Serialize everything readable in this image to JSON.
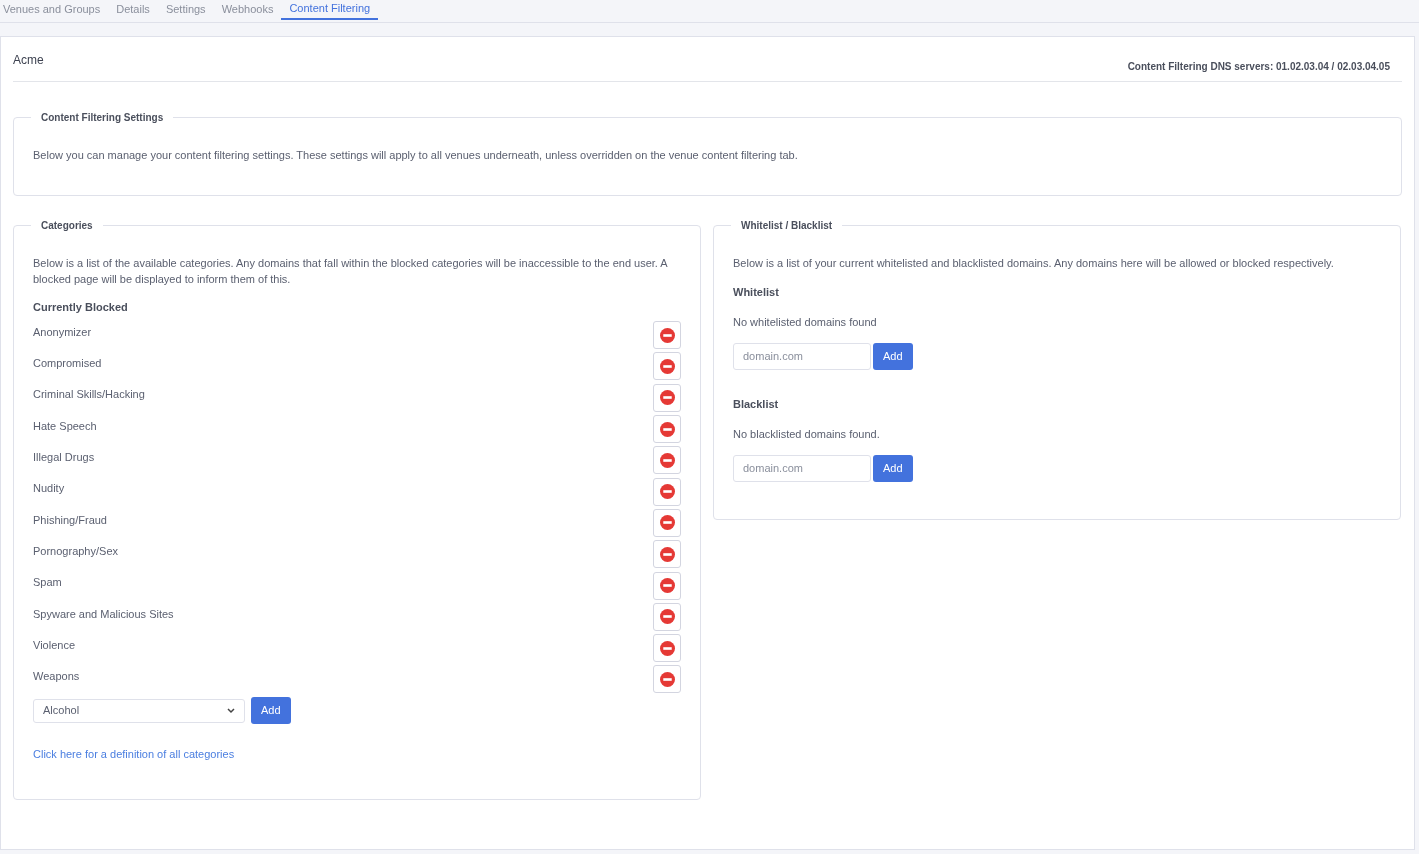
{
  "tabs": [
    {
      "label": "Venues and Groups",
      "selected": false
    },
    {
      "label": "Details",
      "selected": false
    },
    {
      "label": "Settings",
      "selected": false
    },
    {
      "label": "Webhooks",
      "selected": false
    },
    {
      "label": "Content Filtering",
      "selected": true
    }
  ],
  "header": {
    "title": "Acme",
    "dns_servers": "Content Filtering DNS servers: 01.02.03.04 / 02.03.04.05"
  },
  "settings": {
    "legend": "Content Filtering Settings",
    "description": "Below you can manage your content filtering settings. These settings will apply to all venues underneath, unless overridden on the venue content filtering tab."
  },
  "categories": {
    "legend": "Categories",
    "description": "Below is a list of the available categories. Any domains that fall within the blocked categories will be inaccessible to the end user. A blocked page will be displayed to inform them of this.",
    "blocked_heading": "Currently Blocked",
    "blocked": [
      "Anonymizer",
      "Compromised",
      "Criminal Skills/Hacking",
      "Hate Speech",
      "Illegal Drugs",
      "Nudity",
      "Phishing/Fraud",
      "Pornography/Sex",
      "Spam",
      "Spyware and Malicious Sites",
      "Violence",
      "Weapons"
    ],
    "select_value": "Alcohol",
    "add_button": "Add",
    "definition_link": "Click here for a definition of all categories"
  },
  "lists": {
    "legend": "Whitelist / Blacklist",
    "description": "Below is a list of your current whitelisted and blacklisted domains. Any domains here will be allowed or blocked respectively.",
    "sections": [
      {
        "heading": "Whitelist",
        "empty_text": "No whitelisted domains found",
        "placeholder": "domain.com",
        "add_button": "Add"
      },
      {
        "heading": "Blacklist",
        "empty_text": "No blacklisted domains found.",
        "placeholder": "domain.com",
        "add_button": "Add"
      }
    ]
  }
}
